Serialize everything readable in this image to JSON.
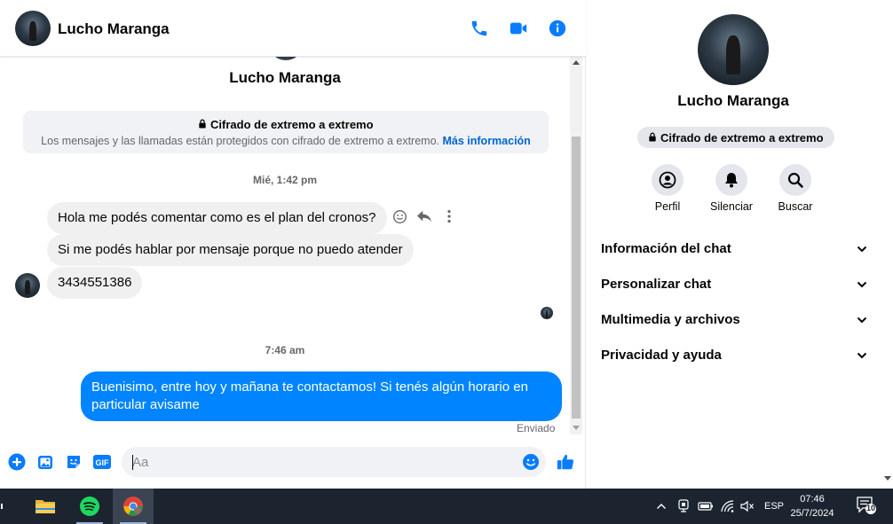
{
  "header": {
    "name": "Lucho Maranga"
  },
  "conversation": {
    "name": "Lucho Maranga",
    "e2e_title": "Cifrado de extremo a extremo",
    "e2e_desc": "Los mensajes y las llamadas están protegidos con cifrado de extremo a extremo.",
    "e2e_link": "Más información",
    "timestamp1": "Mié, 1:42 pm",
    "incoming": [
      "Hola me podés comentar como es el plan del cronos?",
      "Si me podés hablar por mensaje porque no puedo atender",
      "3434551386"
    ],
    "timestamp2": "7:46 am",
    "outgoing": "Buenisimo, entre hoy y mañana te contactamos! Si tenés algún horario en particular avisame",
    "status": "Enviado"
  },
  "composer": {
    "placeholder": "Aa"
  },
  "sidebar": {
    "name": "Lucho Maranga",
    "e2e_pill": "Cifrado de extremo a extremo",
    "actions": [
      "Perfil",
      "Silenciar",
      "Buscar"
    ],
    "sections": [
      "Información del chat",
      "Personalizar chat",
      "Multimedia y archivos",
      "Privacidad y ayuda"
    ]
  },
  "taskbar": {
    "language": "ESP",
    "time": "07:46",
    "date": "25/7/2024",
    "notifications": "10"
  },
  "colors": {
    "accent": "#0084ff",
    "icon_blue": "#0a7cff",
    "bubble_in": "#f0f0f0",
    "taskbar": "#1c2430"
  }
}
